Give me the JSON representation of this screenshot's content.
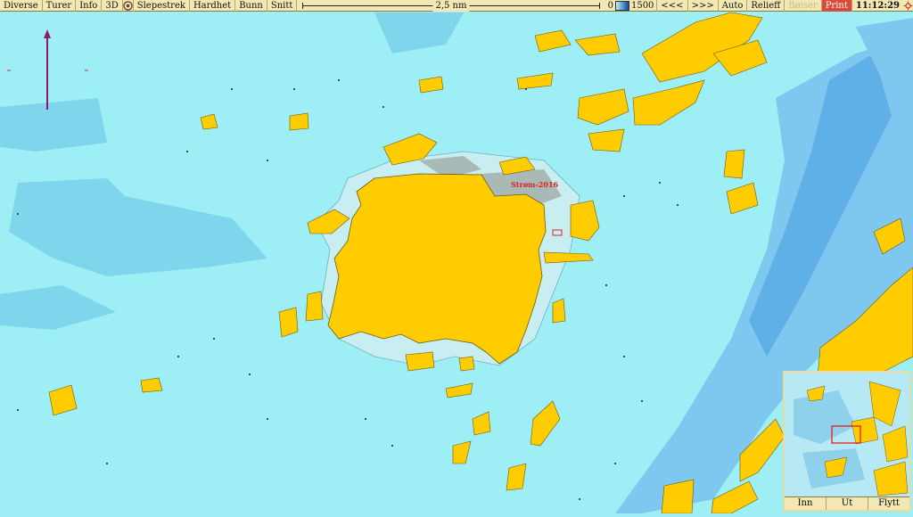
{
  "toolbar": {
    "menu": [
      "Diverse",
      "Turer",
      "Info",
      "3D"
    ],
    "menu2": [
      "Slepestrek",
      "Hardhet",
      "Bunn",
      "Snitt"
    ],
    "scale_label": "2,5 nm",
    "depth_min": "0",
    "depth_max": "1500",
    "nav_prev": "<<<",
    "nav_next": ">>>",
    "auto": "Auto",
    "relieff": "Relieff",
    "boiser": "Bøiser",
    "print": "Print",
    "clock": "11:12:29"
  },
  "map": {
    "place_label": "Strøm-2016",
    "colors": {
      "sea": "#9eeef6",
      "land": "#ffcc00",
      "shallow": "#7fd6ec",
      "deep": "#7ec8f0",
      "drying": "#a9b9b5",
      "contour": "#6fb0c0"
    }
  },
  "minimap": {
    "buttons": [
      "Inn",
      "Ut",
      "Flytt"
    ]
  }
}
